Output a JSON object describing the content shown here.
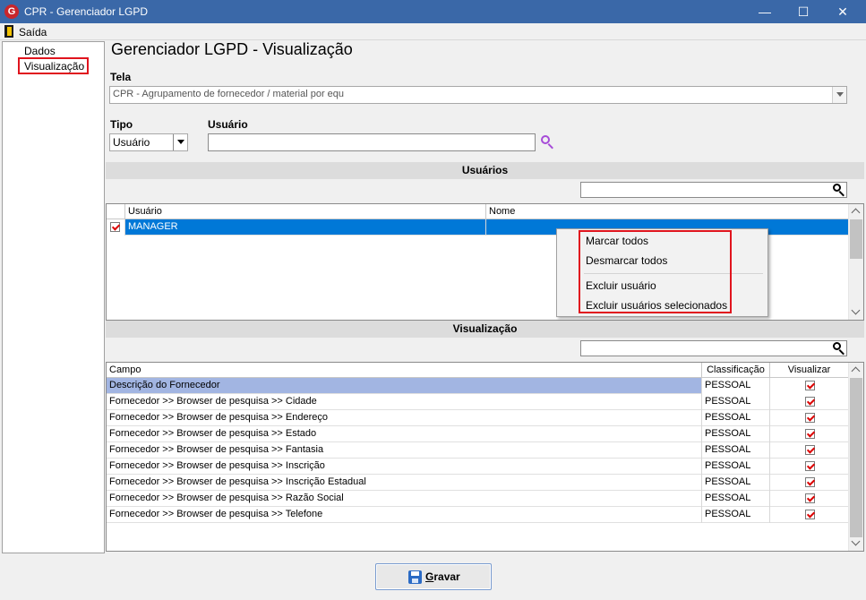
{
  "window": {
    "title": "CPR - Gerenciador LGPD",
    "app_icon_letter": "G",
    "minimize_glyph": "—",
    "maximize_glyph": "☐",
    "close_glyph": "✕"
  },
  "menu": {
    "exit_label": "Saída"
  },
  "sidebar": {
    "items": [
      {
        "label": "Dados"
      },
      {
        "label": "Visualização"
      }
    ]
  },
  "page": {
    "title": "Gerenciador LGPD - Visualização"
  },
  "form": {
    "tela_label": "Tela",
    "tela_value": "CPR - Agrupamento de fornecedor / material por equ",
    "tipo_label": "Tipo",
    "tipo_value": "Usuário",
    "usuario_label": "Usuário",
    "usuario_value": ""
  },
  "users_section": {
    "header": "Usuários",
    "filter_value": "",
    "columns": [
      "Usuário",
      "Nome"
    ],
    "rows": [
      {
        "usuario": "MANAGER",
        "nome": "",
        "checked": true
      }
    ]
  },
  "context_menu": {
    "items": [
      "Marcar todos",
      "Desmarcar todos",
      "Excluir usuário",
      "Excluir usuários selecionados"
    ]
  },
  "view_section": {
    "header": "Visualização",
    "filter_value": "",
    "columns": [
      "Campo",
      "Classificação",
      "Visualizar"
    ],
    "rows": [
      {
        "campo": "Descrição do Fornecedor",
        "classificacao": "PESSOAL",
        "visualizar": true
      },
      {
        "campo": "Fornecedor >> Browser de pesquisa >> Cidade",
        "classificacao": "PESSOAL",
        "visualizar": true
      },
      {
        "campo": "Fornecedor >> Browser de pesquisa >> Endereço",
        "classificacao": "PESSOAL",
        "visualizar": true
      },
      {
        "campo": "Fornecedor >> Browser de pesquisa >> Estado",
        "classificacao": "PESSOAL",
        "visualizar": true
      },
      {
        "campo": "Fornecedor >> Browser de pesquisa >> Fantasia",
        "classificacao": "PESSOAL",
        "visualizar": true
      },
      {
        "campo": "Fornecedor >> Browser de pesquisa >> Inscrição",
        "classificacao": "PESSOAL",
        "visualizar": true
      },
      {
        "campo": "Fornecedor >> Browser de pesquisa >> Inscrição Estadual",
        "classificacao": "PESSOAL",
        "visualizar": true
      },
      {
        "campo": "Fornecedor >> Browser de pesquisa >> Razão Social",
        "classificacao": "PESSOAL",
        "visualizar": true
      },
      {
        "campo": "Fornecedor >> Browser de pesquisa >> Telefone",
        "classificacao": "PESSOAL",
        "visualizar": true
      }
    ]
  },
  "buttons": {
    "save_first": "G",
    "save_rest": "ravar"
  },
  "colors": {
    "titlebar": "#3a68a8",
    "highlight_red": "#e0141e",
    "selection_blue": "#0078d7",
    "selection_lilac": "#a2b5e2",
    "search_purple": "#a64bd8"
  }
}
